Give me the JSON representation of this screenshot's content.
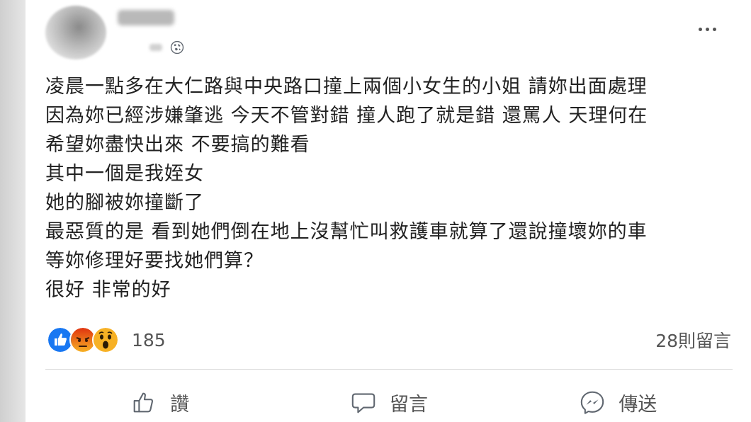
{
  "post": {
    "lines": [
      "凌晨一點多在大仁路與中央路口撞上兩個小女生的小姐 請妳出面處理",
      "因為妳已經涉嫌肇逃 今天不管對錯 撞人跑了就是錯 還罵人 天理何在",
      "希望妳盡快出來 不要搞的難看",
      "其中一個是我姪女",
      "她的腳被妳撞斷了",
      "最惡質的是 看到她們倒在地上沒幫忙叫救護車就算了還說撞壞妳的車",
      "等妳修理好要找她們算？",
      "很好 非常的好"
    ]
  },
  "reactions": {
    "types": [
      "like-icon",
      "angry-icon",
      "wow-icon"
    ],
    "count": "185"
  },
  "comments": {
    "count_label": "28則留言"
  },
  "actions": {
    "like_label": "讚",
    "comment_label": "留言",
    "share_label": "傳送"
  },
  "colors": {
    "like_blue": "#1877f2",
    "angry_orange": "#e9710f",
    "wow_yellow": "#f7b125"
  }
}
